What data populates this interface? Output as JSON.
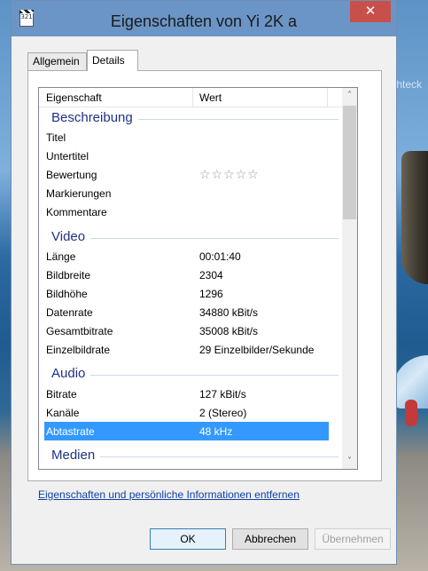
{
  "window": {
    "title": "Eigenschaften von Yi 2K a",
    "icon_text": "321",
    "close_glyph": "✕"
  },
  "background": {
    "ghost_label": "Rechteck"
  },
  "tabs": [
    {
      "label": "Allgemein"
    },
    {
      "label": "Details"
    }
  ],
  "list": {
    "headers": {
      "property": "Eigenschaft",
      "value": "Wert"
    },
    "groups": {
      "beschreibung": "Beschreibung",
      "video": "Video",
      "audio": "Audio",
      "medien": "Medien"
    },
    "beschreibung": [
      {
        "k": "Titel",
        "v": ""
      },
      {
        "k": "Untertitel",
        "v": ""
      },
      {
        "k": "Bewertung",
        "v": "☆☆☆☆☆"
      },
      {
        "k": "Markierungen",
        "v": ""
      },
      {
        "k": "Kommentare",
        "v": ""
      }
    ],
    "video": [
      {
        "k": "Länge",
        "v": "00:01:40"
      },
      {
        "k": "Bildbreite",
        "v": "2304"
      },
      {
        "k": "Bildhöhe",
        "v": "1296"
      },
      {
        "k": "Datenrate",
        "v": "34880 kBit/s"
      },
      {
        "k": "Gesamtbitrate",
        "v": "35008 kBit/s"
      },
      {
        "k": "Einzelbildrate",
        "v": "29 Einzelbilder/Sekunde"
      }
    ],
    "audio": [
      {
        "k": "Bitrate",
        "v": "127 kBit/s"
      },
      {
        "k": "Kanäle",
        "v": "2 (Stereo)"
      },
      {
        "k": "Abtastrate",
        "v": "48 kHz",
        "selected": true
      }
    ],
    "scroll_up": "˄",
    "scroll_down": "˅"
  },
  "remove_link": "Eigenschaften und persönliche Informationen entfernen",
  "buttons": {
    "ok": "OK",
    "cancel": "Abbrechen",
    "apply": "Übernehmen"
  }
}
